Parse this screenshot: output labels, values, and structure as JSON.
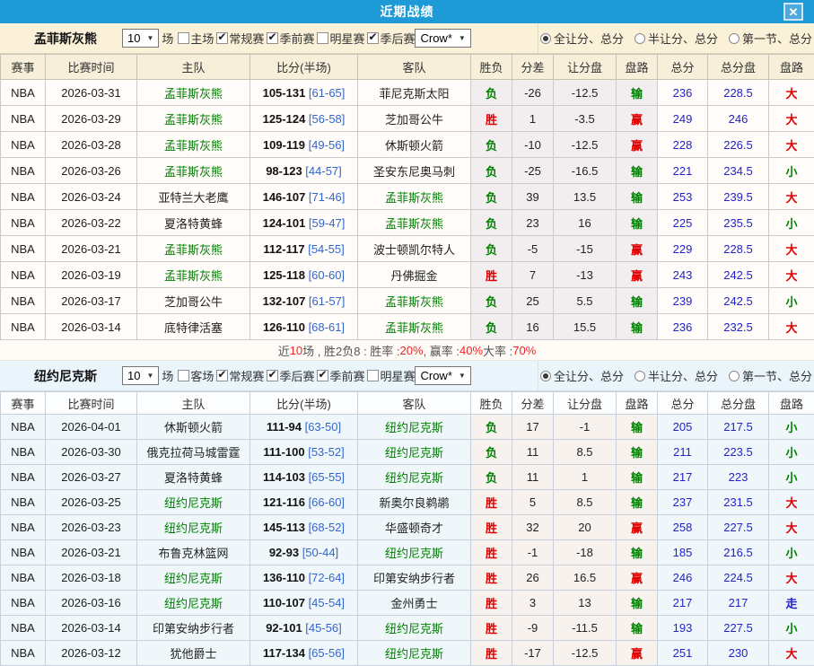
{
  "window": {
    "title": "近期战绩",
    "close_icon": "✕"
  },
  "table_columns": [
    "赛事",
    "比赛时间",
    "主队",
    "比分(半场)",
    "客队",
    "胜负",
    "分差",
    "让分盘",
    "盘路",
    "总分",
    "总分盘",
    "盘路"
  ],
  "radio_options": [
    "全让分、总分",
    "半让分、总分",
    "第一节、总分"
  ],
  "value_colors": {
    "胜": "#E00000",
    "负": "#008000",
    "赢": "#E00000",
    "输": "#008000",
    "大": "#E00000",
    "小": "#008000",
    "走": "#2222CC"
  },
  "sections": [
    {
      "team": "孟菲斯灰熊",
      "games_select": "10",
      "games_unit": "场",
      "odds_select": "Crow*",
      "selected_radio_index": 0,
      "filter_checkboxes": [
        {
          "label": "主场",
          "checked": false
        },
        {
          "label": "常规赛",
          "checked": true
        },
        {
          "label": "季前赛",
          "checked": true
        },
        {
          "label": "明星赛",
          "checked": false
        },
        {
          "label": "季后赛",
          "checked": true
        }
      ],
      "rows": [
        {
          "league": "NBA",
          "date": "2026-03-31",
          "home": "孟菲斯灰熊",
          "score": "105-131",
          "half": "[61-65]",
          "away": "菲尼克斯太阳",
          "win_loss": "负",
          "margin": "-26",
          "handicap_line": "-12.5",
          "handicap_result": "输",
          "total": "236",
          "total_line": "228.5",
          "over_under": "大"
        },
        {
          "league": "NBA",
          "date": "2026-03-29",
          "home": "孟菲斯灰熊",
          "score": "125-124",
          "half": "[56-58]",
          "away": "芝加哥公牛",
          "win_loss": "胜",
          "margin": "1",
          "handicap_line": "-3.5",
          "handicap_result": "赢",
          "total": "249",
          "total_line": "246",
          "over_under": "大"
        },
        {
          "league": "NBA",
          "date": "2026-03-28",
          "home": "孟菲斯灰熊",
          "score": "109-119",
          "half": "[49-56]",
          "away": "休斯顿火箭",
          "win_loss": "负",
          "margin": "-10",
          "handicap_line": "-12.5",
          "handicap_result": "赢",
          "total": "228",
          "total_line": "226.5",
          "over_under": "大"
        },
        {
          "league": "NBA",
          "date": "2026-03-26",
          "home": "孟菲斯灰熊",
          "score": "98-123",
          "half": "[44-57]",
          "away": "圣安东尼奥马刺",
          "win_loss": "负",
          "margin": "-25",
          "handicap_line": "-16.5",
          "handicap_result": "输",
          "total": "221",
          "total_line": "234.5",
          "over_under": "小"
        },
        {
          "league": "NBA",
          "date": "2026-03-24",
          "home": "亚特兰大老鹰",
          "score": "146-107",
          "half": "[71-46]",
          "away": "孟菲斯灰熊",
          "win_loss": "负",
          "margin": "39",
          "handicap_line": "13.5",
          "handicap_result": "输",
          "total": "253",
          "total_line": "239.5",
          "over_under": "大"
        },
        {
          "league": "NBA",
          "date": "2026-03-22",
          "home": "夏洛特黄蜂",
          "score": "124-101",
          "half": "[59-47]",
          "away": "孟菲斯灰熊",
          "win_loss": "负",
          "margin": "23",
          "handicap_line": "16",
          "handicap_result": "输",
          "total": "225",
          "total_line": "235.5",
          "over_under": "小"
        },
        {
          "league": "NBA",
          "date": "2026-03-21",
          "home": "孟菲斯灰熊",
          "score": "112-117",
          "half": "[54-55]",
          "away": "波士顿凯尔特人",
          "win_loss": "负",
          "margin": "-5",
          "handicap_line": "-15",
          "handicap_result": "赢",
          "total": "229",
          "total_line": "228.5",
          "over_under": "大"
        },
        {
          "league": "NBA",
          "date": "2026-03-19",
          "home": "孟菲斯灰熊",
          "score": "125-118",
          "half": "[60-60]",
          "away": "丹佛掘金",
          "win_loss": "胜",
          "margin": "7",
          "handicap_line": "-13",
          "handicap_result": "赢",
          "total": "243",
          "total_line": "242.5",
          "over_under": "大"
        },
        {
          "league": "NBA",
          "date": "2026-03-17",
          "home": "芝加哥公牛",
          "score": "132-107",
          "half": "[61-57]",
          "away": "孟菲斯灰熊",
          "win_loss": "负",
          "margin": "25",
          "handicap_line": "5.5",
          "handicap_result": "输",
          "total": "239",
          "total_line": "242.5",
          "over_under": "小"
        },
        {
          "league": "NBA",
          "date": "2026-03-14",
          "home": "底特律活塞",
          "score": "126-110",
          "half": "[68-61]",
          "away": "孟菲斯灰熊",
          "win_loss": "负",
          "margin": "16",
          "handicap_line": "15.5",
          "handicap_result": "输",
          "total": "236",
          "total_line": "232.5",
          "over_under": "大"
        }
      ],
      "summary_parts": [
        {
          "text": "近 ",
          "red": false
        },
        {
          "text": "10",
          "red": true
        },
        {
          "text": " 场 , 胜2负8 : 胜率 : ",
          "red": false
        },
        {
          "text": "20%",
          "red": true
        },
        {
          "text": " , 赢率 : ",
          "red": false
        },
        {
          "text": "40%",
          "red": true
        },
        {
          "text": " 大率 : ",
          "red": false
        },
        {
          "text": "70%",
          "red": true
        }
      ]
    },
    {
      "team": "纽约尼克斯",
      "games_select": "10",
      "games_unit": "场",
      "odds_select": "Crow*",
      "selected_radio_index": 0,
      "filter_checkboxes": [
        {
          "label": "客场",
          "checked": false
        },
        {
          "label": "常规赛",
          "checked": true
        },
        {
          "label": "季后赛",
          "checked": true
        },
        {
          "label": "季前赛",
          "checked": true
        },
        {
          "label": "明星赛",
          "checked": false
        }
      ],
      "rows": [
        {
          "league": "NBA",
          "date": "2026-04-01",
          "home": "休斯顿火箭",
          "score": "111-94",
          "half": "[63-50]",
          "away": "纽约尼克斯",
          "win_loss": "负",
          "margin": "17",
          "handicap_line": "-1",
          "handicap_result": "输",
          "total": "205",
          "total_line": "217.5",
          "over_under": "小"
        },
        {
          "league": "NBA",
          "date": "2026-03-30",
          "home": "俄克拉荷马城雷霆",
          "score": "111-100",
          "half": "[53-52]",
          "away": "纽约尼克斯",
          "win_loss": "负",
          "margin": "11",
          "handicap_line": "8.5",
          "handicap_result": "输",
          "total": "211",
          "total_line": "223.5",
          "over_under": "小"
        },
        {
          "league": "NBA",
          "date": "2026-03-27",
          "home": "夏洛特黄蜂",
          "score": "114-103",
          "half": "[65-55]",
          "away": "纽约尼克斯",
          "win_loss": "负",
          "margin": "11",
          "handicap_line": "1",
          "handicap_result": "输",
          "total": "217",
          "total_line": "223",
          "over_under": "小"
        },
        {
          "league": "NBA",
          "date": "2026-03-25",
          "home": "纽约尼克斯",
          "score": "121-116",
          "half": "[66-60]",
          "away": "新奥尔良鹈鹕",
          "win_loss": "胜",
          "margin": "5",
          "handicap_line": "8.5",
          "handicap_result": "输",
          "total": "237",
          "total_line": "231.5",
          "over_under": "大"
        },
        {
          "league": "NBA",
          "date": "2026-03-23",
          "home": "纽约尼克斯",
          "score": "145-113",
          "half": "[68-52]",
          "away": "华盛顿奇才",
          "win_loss": "胜",
          "margin": "32",
          "handicap_line": "20",
          "handicap_result": "赢",
          "total": "258",
          "total_line": "227.5",
          "over_under": "大"
        },
        {
          "league": "NBA",
          "date": "2026-03-21",
          "home": "布鲁克林篮网",
          "score": "92-93",
          "half": "[50-44]",
          "away": "纽约尼克斯",
          "win_loss": "胜",
          "margin": "-1",
          "handicap_line": "-18",
          "handicap_result": "输",
          "total": "185",
          "total_line": "216.5",
          "over_under": "小"
        },
        {
          "league": "NBA",
          "date": "2026-03-18",
          "home": "纽约尼克斯",
          "score": "136-110",
          "half": "[72-64]",
          "away": "印第安纳步行者",
          "win_loss": "胜",
          "margin": "26",
          "handicap_line": "16.5",
          "handicap_result": "赢",
          "total": "246",
          "total_line": "224.5",
          "over_under": "大"
        },
        {
          "league": "NBA",
          "date": "2026-03-16",
          "home": "纽约尼克斯",
          "score": "110-107",
          "half": "[45-54]",
          "away": "金州勇士",
          "win_loss": "胜",
          "margin": "3",
          "handicap_line": "13",
          "handicap_result": "输",
          "total": "217",
          "total_line": "217",
          "over_under": "走"
        },
        {
          "league": "NBA",
          "date": "2026-03-14",
          "home": "印第安纳步行者",
          "score": "92-101",
          "half": "[45-56]",
          "away": "纽约尼克斯",
          "win_loss": "胜",
          "margin": "-9",
          "handicap_line": "-11.5",
          "handicap_result": "输",
          "total": "193",
          "total_line": "227.5",
          "over_under": "小"
        },
        {
          "league": "NBA",
          "date": "2026-03-12",
          "home": "犹他爵士",
          "score": "117-134",
          "half": "[65-56]",
          "away": "纽约尼克斯",
          "win_loss": "胜",
          "margin": "-17",
          "handicap_line": "-12.5",
          "handicap_result": "赢",
          "total": "251",
          "total_line": "230",
          "over_under": "大"
        }
      ],
      "summary_parts": []
    }
  ]
}
